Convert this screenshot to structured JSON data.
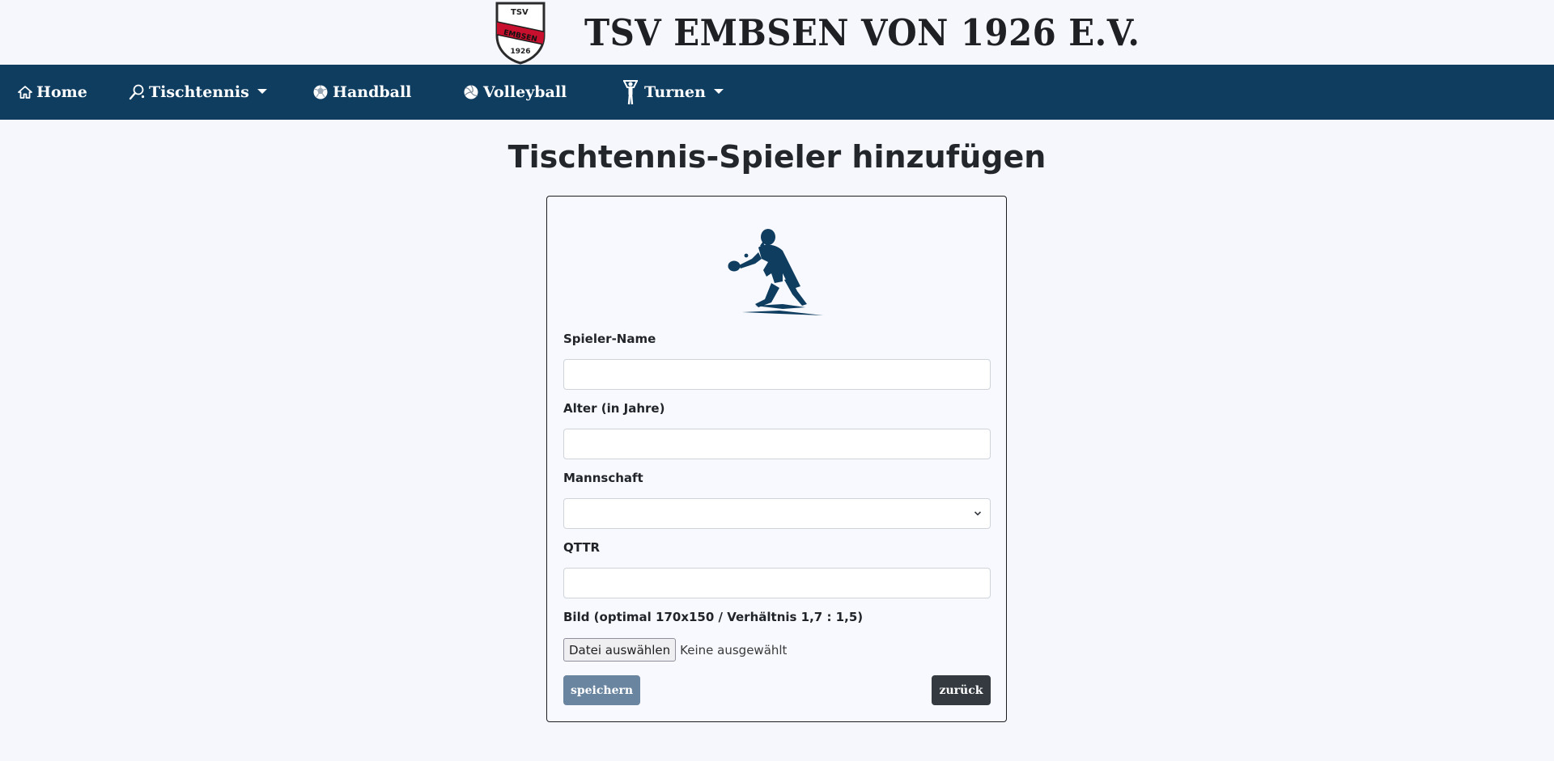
{
  "header": {
    "logo": {
      "top_text": "TSV",
      "band_text": "EMBSEN",
      "year_text": "1926",
      "band_color": "#c8102e"
    },
    "title": "TSV EMBSEN VON 1926 E.V."
  },
  "nav": {
    "background": "#0f3d60",
    "items": [
      {
        "label": "Home",
        "icon": "home-icon",
        "dropdown": false
      },
      {
        "label": "Tischtennis",
        "icon": "table-tennis-paddle-icon",
        "dropdown": true
      },
      {
        "label": "Handball",
        "icon": "handball-icon",
        "dropdown": false
      },
      {
        "label": "Volleyball",
        "icon": "volleyball-icon",
        "dropdown": false
      },
      {
        "label": "Turnen",
        "icon": "gymnast-icon",
        "dropdown": true
      }
    ]
  },
  "page": {
    "title": "Tischtennis-Spieler hinzufügen"
  },
  "form": {
    "image": "table-tennis-player-illustration",
    "fields": {
      "name": {
        "label": "Spieler-Name",
        "value": ""
      },
      "age": {
        "label": "Alter (in Jahre)",
        "value": ""
      },
      "team": {
        "label": "Mannschaft",
        "value": ""
      },
      "qttr": {
        "label": "QTTR",
        "value": ""
      },
      "picture": {
        "label": "Bild (optimal 170x150 / Verhältnis 1,7 : 1,5)",
        "button_label": "Datei auswählen",
        "status": "Keine ausgewählt"
      }
    },
    "save_label": "speichern",
    "back_label": "zurück"
  }
}
